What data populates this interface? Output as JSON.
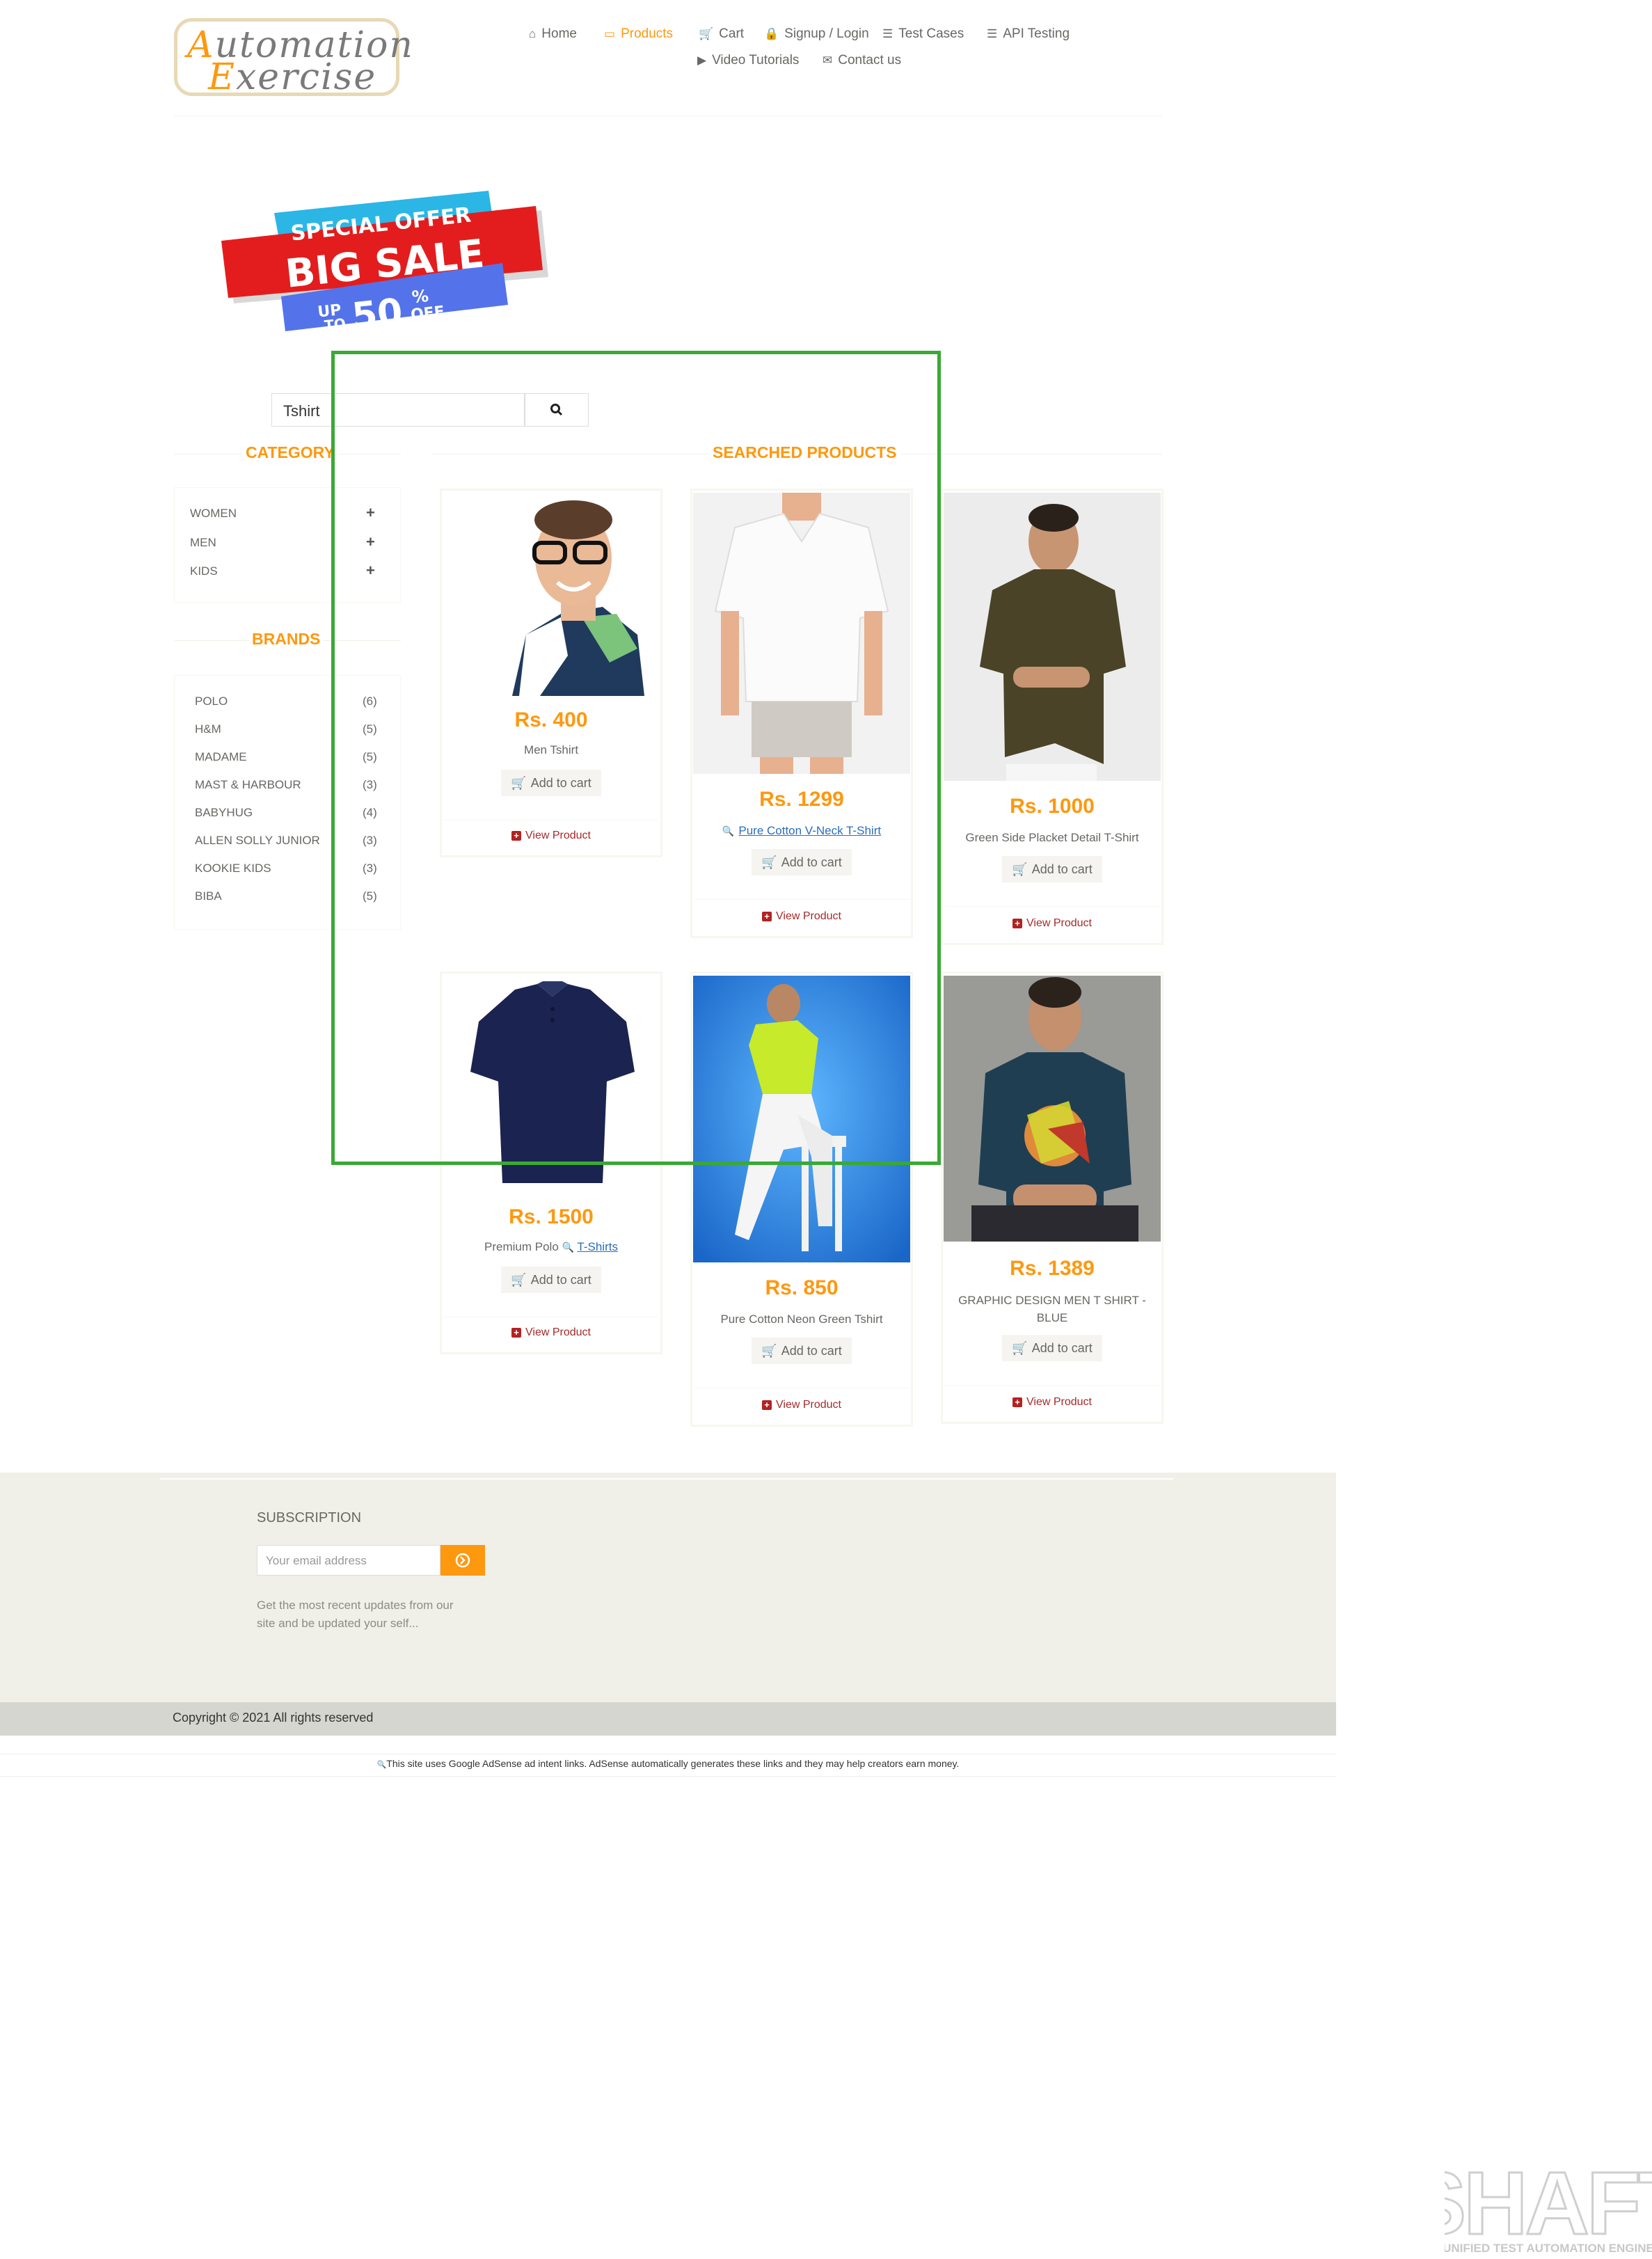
{
  "header": {
    "logo_line1_cap": "A",
    "logo_line1_rest": "utomation",
    "logo_line2_cap": "E",
    "logo_line2_rest": "xercise",
    "nav": [
      {
        "label": "Home",
        "icon": "home-icon",
        "active": false
      },
      {
        "label": "Products",
        "icon": "products-icon",
        "active": true
      },
      {
        "label": "Cart",
        "icon": "cart-icon",
        "active": false
      },
      {
        "label": "Signup / Login",
        "icon": "lock-icon",
        "active": false
      },
      {
        "label": "Test Cases",
        "icon": "list-icon",
        "active": false
      },
      {
        "label": "API Testing",
        "icon": "list-icon",
        "active": false
      },
      {
        "label": "Video Tutorials",
        "icon": "youtube-icon",
        "active": false
      },
      {
        "label": "Contact us",
        "icon": "envelope-icon",
        "active": false
      }
    ]
  },
  "banner": {
    "line1": "SPECIAL OFFER",
    "line2": "BIG SALE",
    "up": "UP",
    "to": "TO",
    "pct": "50",
    "pct_sign": "%",
    "off": "OFF"
  },
  "search": {
    "value": "Tshirt"
  },
  "sidebar": {
    "category_title": "CATEGORY",
    "categories": [
      "WOMEN",
      "MEN",
      "KIDS"
    ],
    "brands_title": "BRANDS",
    "brands": [
      {
        "name": "POLO",
        "count": "(6)"
      },
      {
        "name": "H&M",
        "count": "(5)"
      },
      {
        "name": "MADAME",
        "count": "(5)"
      },
      {
        "name": "MAST & HARBOUR",
        "count": "(3)"
      },
      {
        "name": "BABYHUG",
        "count": "(4)"
      },
      {
        "name": "ALLEN SOLLY JUNIOR",
        "count": "(3)"
      },
      {
        "name": "KOOKIE KIDS",
        "count": "(3)"
      },
      {
        "name": "BIBA",
        "count": "(5)"
      }
    ]
  },
  "products_title": "SEARCHED PRODUCTS",
  "products": [
    {
      "price": "Rs. 400",
      "name": "Men Tshirt",
      "add": "Add to cart",
      "view": "View Product"
    },
    {
      "price": "Rs. 1299",
      "name": "Pure Cotton V-Neck T-Shirt",
      "add": "Add to cart",
      "view": "View Product"
    },
    {
      "price": "Rs. 1000",
      "name": "Green Side Placket Detail T-Shirt",
      "add": "Add to cart",
      "view": "View Product"
    },
    {
      "price": "Rs. 1500",
      "name_prefix": "Premium Polo",
      "name_link": "T-Shirts",
      "add": "Add to cart",
      "view": "View Product"
    },
    {
      "price": "Rs. 850",
      "name": "Pure Cotton Neon Green Tshirt",
      "add": "Add to cart",
      "view": "View Product"
    },
    {
      "price": "Rs. 1389",
      "name": "GRAPHIC DESIGN MEN T SHIRT - BLUE",
      "add": "Add to cart",
      "view": "View Product"
    }
  ],
  "footer": {
    "subscription_title": "SUBSCRIPTION",
    "email_placeholder": "Your email address",
    "desc": "Get the most recent updates from our site and be updated your self...",
    "copyright": "Copyright © 2021 All rights reserved",
    "adsense": "This site uses Google AdSense ad intent links. AdSense automatically generates these links and they may help creators earn money."
  },
  "watermark": {
    "title": "SHAFT",
    "subtitle": "UNIFIED TEST AUTOMATION ENGINE"
  },
  "colors": {
    "accent": "#fe980f",
    "highlight": "#3aa935",
    "link": "#2a6ebb"
  }
}
